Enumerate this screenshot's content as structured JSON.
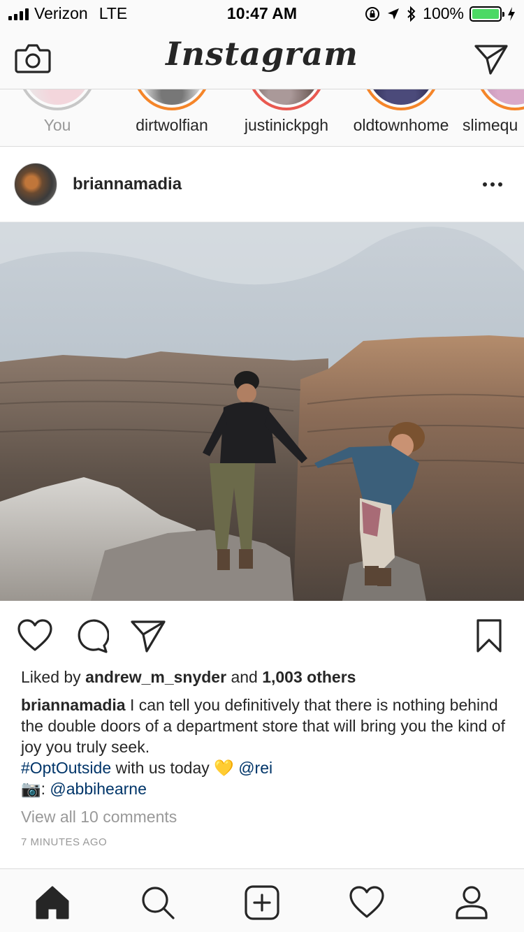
{
  "status_bar": {
    "carrier": "Verizon",
    "network": "LTE",
    "time": "10:47 AM",
    "battery_percent": "100%",
    "battery_level": 1.0,
    "battery_color": "#4cd964"
  },
  "navbar": {
    "logo": "Instagram",
    "left_icon": "camera-icon",
    "right_icon": "direct-message-icon"
  },
  "stories": [
    {
      "label": "You",
      "seen": true
    },
    {
      "label": "dirtwolfian",
      "seen": false
    },
    {
      "label": "justinickpgh",
      "seen": false
    },
    {
      "label": "oldtownhome",
      "seen": false
    },
    {
      "label": "slimequ",
      "seen": false
    }
  ],
  "post": {
    "username": "briannamadia",
    "more_icon": "more-options-icon",
    "likes_prefix": "Liked by",
    "liked_by_user": "andrew_m_snyder",
    "likes_conjunction": "and",
    "likes_others": "1,003 others",
    "caption_user": "briannamadia",
    "caption_text": "I can tell you definitively that there is nothing behind the double doors of a department store that will bring you the kind of joy you truly seek.",
    "hashtag": "#OptOutside",
    "caption_mid": "with us today",
    "emoji_heart": "💛",
    "mention_rei": "@rei",
    "emoji_camera": "📷",
    "photo_credit_sep": ":",
    "mention_photographer": "@abbihearne",
    "view_comments": "View all 10 comments",
    "timestamp": "7 MINUTES AGO"
  },
  "colors": {
    "link": "#003569",
    "muted": "#999999",
    "text": "#262626",
    "story_ring": "#e1306c"
  },
  "tabbar": {
    "items": [
      "home-icon",
      "search-icon",
      "new-post-icon",
      "activity-heart-icon",
      "profile-icon"
    ],
    "active": "home-icon"
  }
}
